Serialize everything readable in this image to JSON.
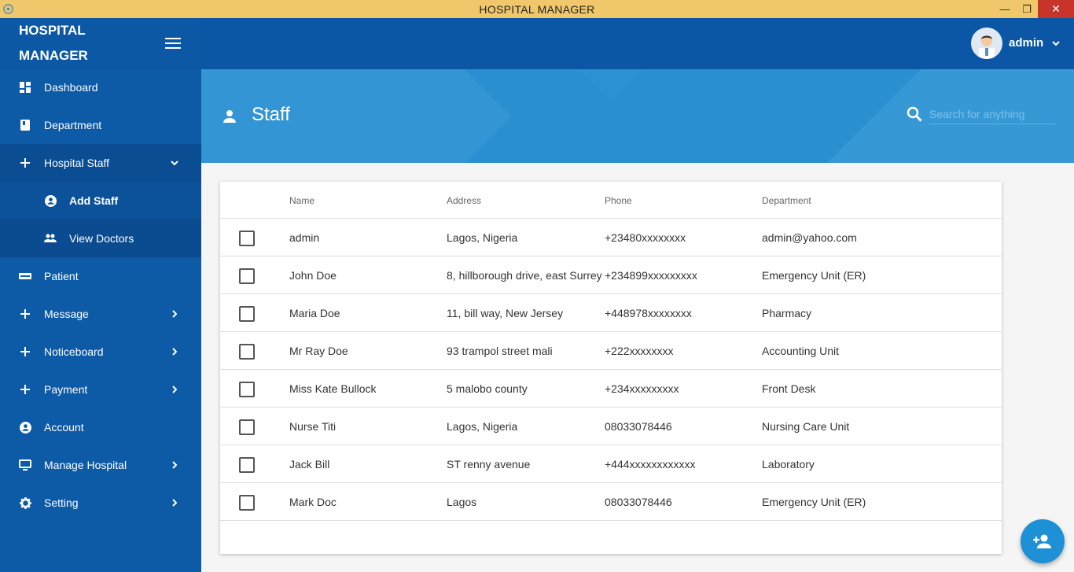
{
  "window": {
    "title": "HOSPITAL MANAGER",
    "minimize": "—",
    "maximize": "❐",
    "close": "✕"
  },
  "sidebar": {
    "brand_line1": "HOSPITAL",
    "brand_line2": "MANAGER",
    "items": [
      {
        "label": "Dashboard",
        "icon": "dashboard-icon"
      },
      {
        "label": "Department",
        "icon": "book-icon"
      },
      {
        "label": "Hospital Staff",
        "icon": "plus-icon",
        "expanded": true
      },
      {
        "label": "Add Staff",
        "icon": "account-circle-icon"
      },
      {
        "label": "View Doctors",
        "icon": "people-icon"
      },
      {
        "label": "Patient",
        "icon": "card-icon"
      },
      {
        "label": "Message",
        "icon": "plus-icon"
      },
      {
        "label": "Noticeboard",
        "icon": "plus-icon"
      },
      {
        "label": "Payment",
        "icon": "plus-icon"
      },
      {
        "label": "Account",
        "icon": "account-circle-icon"
      },
      {
        "label": "Manage Hospital",
        "icon": "monitor-icon"
      },
      {
        "label": "Setting",
        "icon": "gear-icon"
      }
    ]
  },
  "topbar": {
    "user_name": "admin"
  },
  "header": {
    "title": "Staff",
    "search_placeholder": "Search for anything"
  },
  "table": {
    "columns": [
      "Name",
      "Address",
      "Phone",
      "Department"
    ],
    "rows": [
      [
        "admin",
        "Lagos, Nigeria",
        "+23480xxxxxxxx",
        "admin@yahoo.com"
      ],
      [
        "John Doe",
        "8, hillborough drive, east Surrey",
        "+234899xxxxxxxxx",
        "Emergency Unit (ER)"
      ],
      [
        "Maria Doe",
        "11, bill way, New Jersey",
        "+448978xxxxxxxx",
        "Pharmacy"
      ],
      [
        "Mr Ray Doe",
        "93 trampol street mali",
        "+222xxxxxxxx",
        "Accounting Unit"
      ],
      [
        "Miss Kate Bullock",
        "5 malobo county",
        "+234xxxxxxxxx",
        "Front Desk"
      ],
      [
        "Nurse Titi",
        "Lagos, Nigeria",
        "08033078446",
        "Nursing Care Unit"
      ],
      [
        "Jack Bill",
        "ST renny avenue",
        "+444xxxxxxxxxxxx",
        "Laboratory"
      ],
      [
        "Mark Doc",
        "Lagos",
        "08033078446",
        "Emergency Unit (ER)"
      ]
    ]
  },
  "colors": {
    "sidebar": "#0d5aa7",
    "topbar": "#0b56a5",
    "band": "#2a8fd0",
    "titlebar": "#f0c76a",
    "fab": "#1e90d6"
  }
}
